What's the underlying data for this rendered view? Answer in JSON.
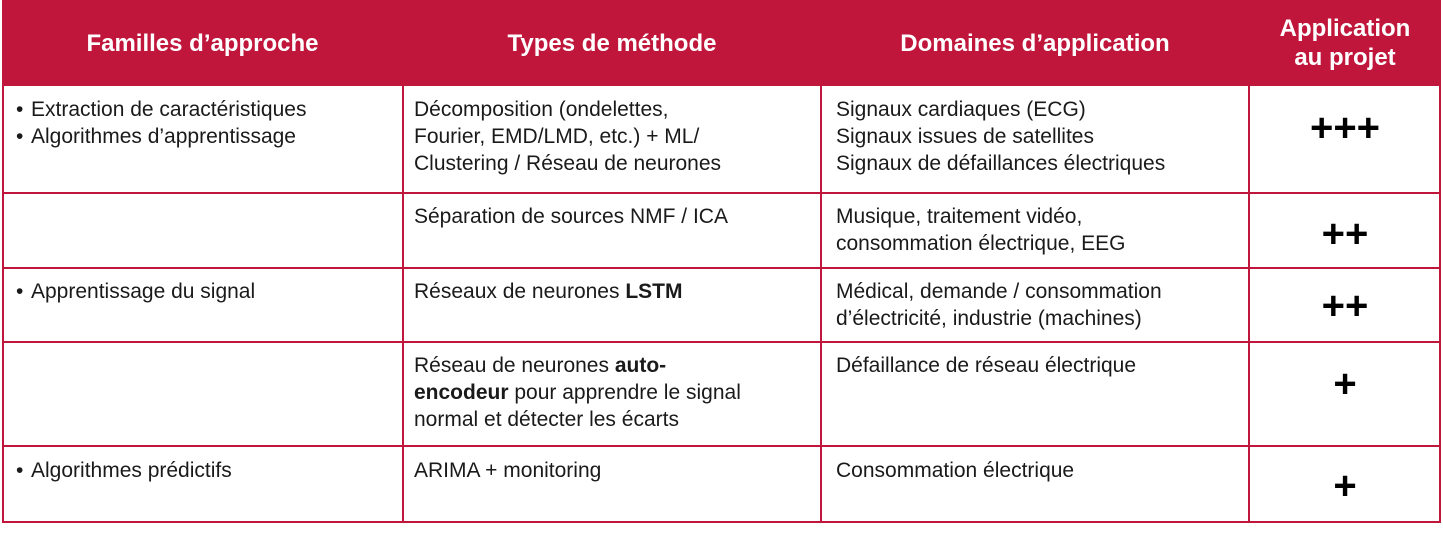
{
  "header": {
    "col1": "Familles d’approche",
    "col2": "Types de méthode",
    "col3": "Domaines d’application",
    "col4_line1": "Application",
    "col4_line2": "au projet"
  },
  "rows": [
    {
      "familles": [
        "Extraction de caractéristiques",
        "Algorithmes d’apprentissage"
      ],
      "methode": [
        "Décomposition (ondelettes,",
        "Fourier, EMD/LMD, etc.) + ML/",
        "Clustering / Réseau de neurones"
      ],
      "domaines": [
        "Signaux cardiaques (ECG)",
        "Signaux issues de satellites",
        "Signaux de défaillances électriques"
      ],
      "rating": "+++"
    },
    {
      "familles": [],
      "methode": [
        "Séparation de sources NMF / ICA"
      ],
      "domaines": [
        "Musique, traitement vidéo,",
        "consommation électrique, EEG"
      ],
      "rating": "++"
    },
    {
      "familles": [
        "Apprentissage du signal"
      ],
      "methode_pre": "Réseaux de neurones ",
      "methode_bold": "LSTM",
      "domaines": [
        "Médical, demande / consommation",
        "d’électricité, industrie (machines)"
      ],
      "rating": "++"
    },
    {
      "familles": [],
      "methode_l1_pre": "Réseau de neurones ",
      "methode_l1_bold": "auto-",
      "methode_l2_bold": "encodeur",
      "methode_l2_post": " pour apprendre le signal",
      "methode_l3": "normal et détecter les écarts",
      "domaines": [
        "Défaillance de réseau électrique"
      ],
      "rating": "+"
    },
    {
      "familles": [
        "Algorithmes prédictifs"
      ],
      "methode": [
        "ARIMA + monitoring"
      ],
      "domaines": [
        "Consommation électrique"
      ],
      "rating": "+"
    }
  ],
  "colors": {
    "header_bg": "#c0163b",
    "header_text": "#ffffff",
    "border": "#c0163b"
  }
}
